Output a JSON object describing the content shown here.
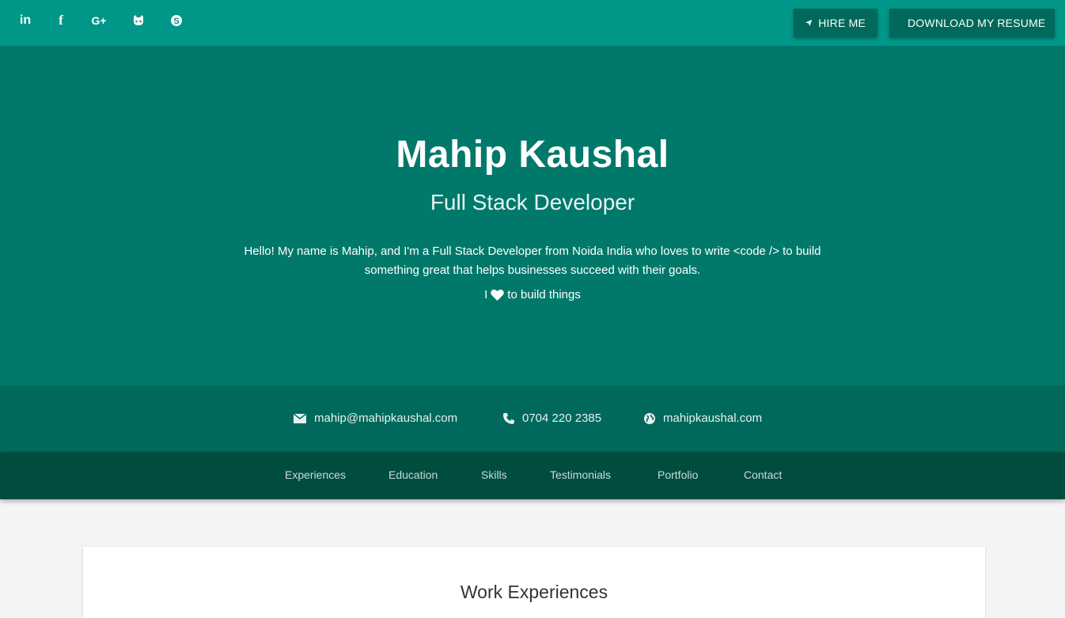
{
  "social": {
    "icons": [
      "linkedin-icon",
      "facebook-icon",
      "google-plus-icon",
      "github-icon",
      "skype-icon"
    ]
  },
  "header": {
    "hire_label": "HIRE ME",
    "resume_label": "DOWNLOAD MY RESUME"
  },
  "hero": {
    "name": "Mahip Kaushal",
    "role": "Full Stack Developer",
    "bio": "Hello! My name is Mahip, and I'm a Full Stack Developer from Noida India who loves to write <code /> to build something great that helps businesses succeed with their goals.",
    "love_prefix": "I",
    "love_suffix": "to build things"
  },
  "contact": {
    "email": "mahip@mahipkaushal.com",
    "phone": "0704 220 2385",
    "website": "mahipkaushal.com"
  },
  "nav": {
    "items": [
      "Experiences",
      "Education",
      "Skills",
      "Testimonials",
      "Portfolio",
      "Contact"
    ]
  },
  "main": {
    "section_title": "Work Experiences"
  },
  "colors": {
    "topbar": "#009688",
    "hero": "#00796b",
    "contact": "#00695c",
    "nav": "#004d40",
    "page_bg": "#f4f4f4"
  }
}
